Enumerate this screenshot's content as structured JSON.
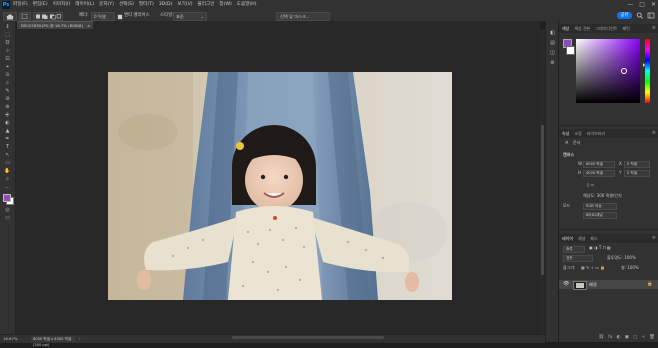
{
  "menubar": {
    "logo": "Ps",
    "items": [
      "파일(F)",
      "편집(E)",
      "이미지(I)",
      "레이어(L)",
      "문자(Y)",
      "선택(S)",
      "필터(T)",
      "3D(D)",
      "보기(V)",
      "플러그인",
      "창(W)",
      "도움말(H)"
    ],
    "window_controls": [
      "—",
      "□",
      "✕"
    ]
  },
  "options": {
    "feather_label": "페더:",
    "feather_value": "0 픽셀",
    "antialias_label": "앤티 앨리어스",
    "style_label": "스타일:",
    "style_value": "표준",
    "select_mask_label": "선택 및 마스크...",
    "share_label": "공유"
  },
  "document": {
    "tab_title": "DSC07839.JPG @ 16.7% (RGB/8)",
    "tab_close": "×",
    "zoom": "16.67%",
    "dimensions": "6000 픽셀 x 4000 픽셀 (300 ppi)",
    "status_arrow": "›"
  },
  "toolbar": {
    "tools": [
      "↕",
      "⬚",
      "ʘ",
      "⊹",
      "⊡",
      "⌖",
      "⊙",
      "⌕",
      "✎",
      "⊘",
      "⊚",
      "⎆",
      "◐",
      "▲",
      "✒",
      "T",
      "↖",
      "▭",
      "✋",
      "⌕",
      "…"
    ]
  },
  "color_panel": {
    "tabs": [
      "색상",
      "색상 견본",
      "그레이디언트",
      "패턴"
    ],
    "fg_color": "#8d4fb5",
    "bg_color": "#ffffff"
  },
  "properties_panel": {
    "tabs": [
      "속성",
      "조정",
      "라이브러리"
    ],
    "doc_label": "문서",
    "canvas_label": "캔버스",
    "w_label": "W",
    "w_value": "6000 픽셀",
    "h_label": "H",
    "h_value": "4000 픽셀",
    "x_label": "X",
    "x_value": "0 픽셀",
    "y_label": "Y",
    "y_value": "0 픽셀",
    "resolution_label": "해상도: 300 픽셀/인치",
    "mode_label": "모드",
    "mode_value": "RGB 색상",
    "depth_value": "8비트/채널"
  },
  "layers_panel": {
    "tabs": [
      "레이어",
      "채널",
      "패스"
    ],
    "filter_label": "종류",
    "blend_value": "표준",
    "opacity_label": "불투명도: 100%",
    "lock_label": "잠그기:",
    "fill_label": "칠: 100%",
    "layer_name": "배경",
    "lock_icon_glyph": "🔒",
    "footer_icons": [
      "⛓",
      "fx",
      "◐",
      "▣",
      "▢",
      "+",
      "🗑"
    ]
  },
  "icon_strip": [
    "◧",
    "▤",
    "◫",
    "⚙"
  ]
}
